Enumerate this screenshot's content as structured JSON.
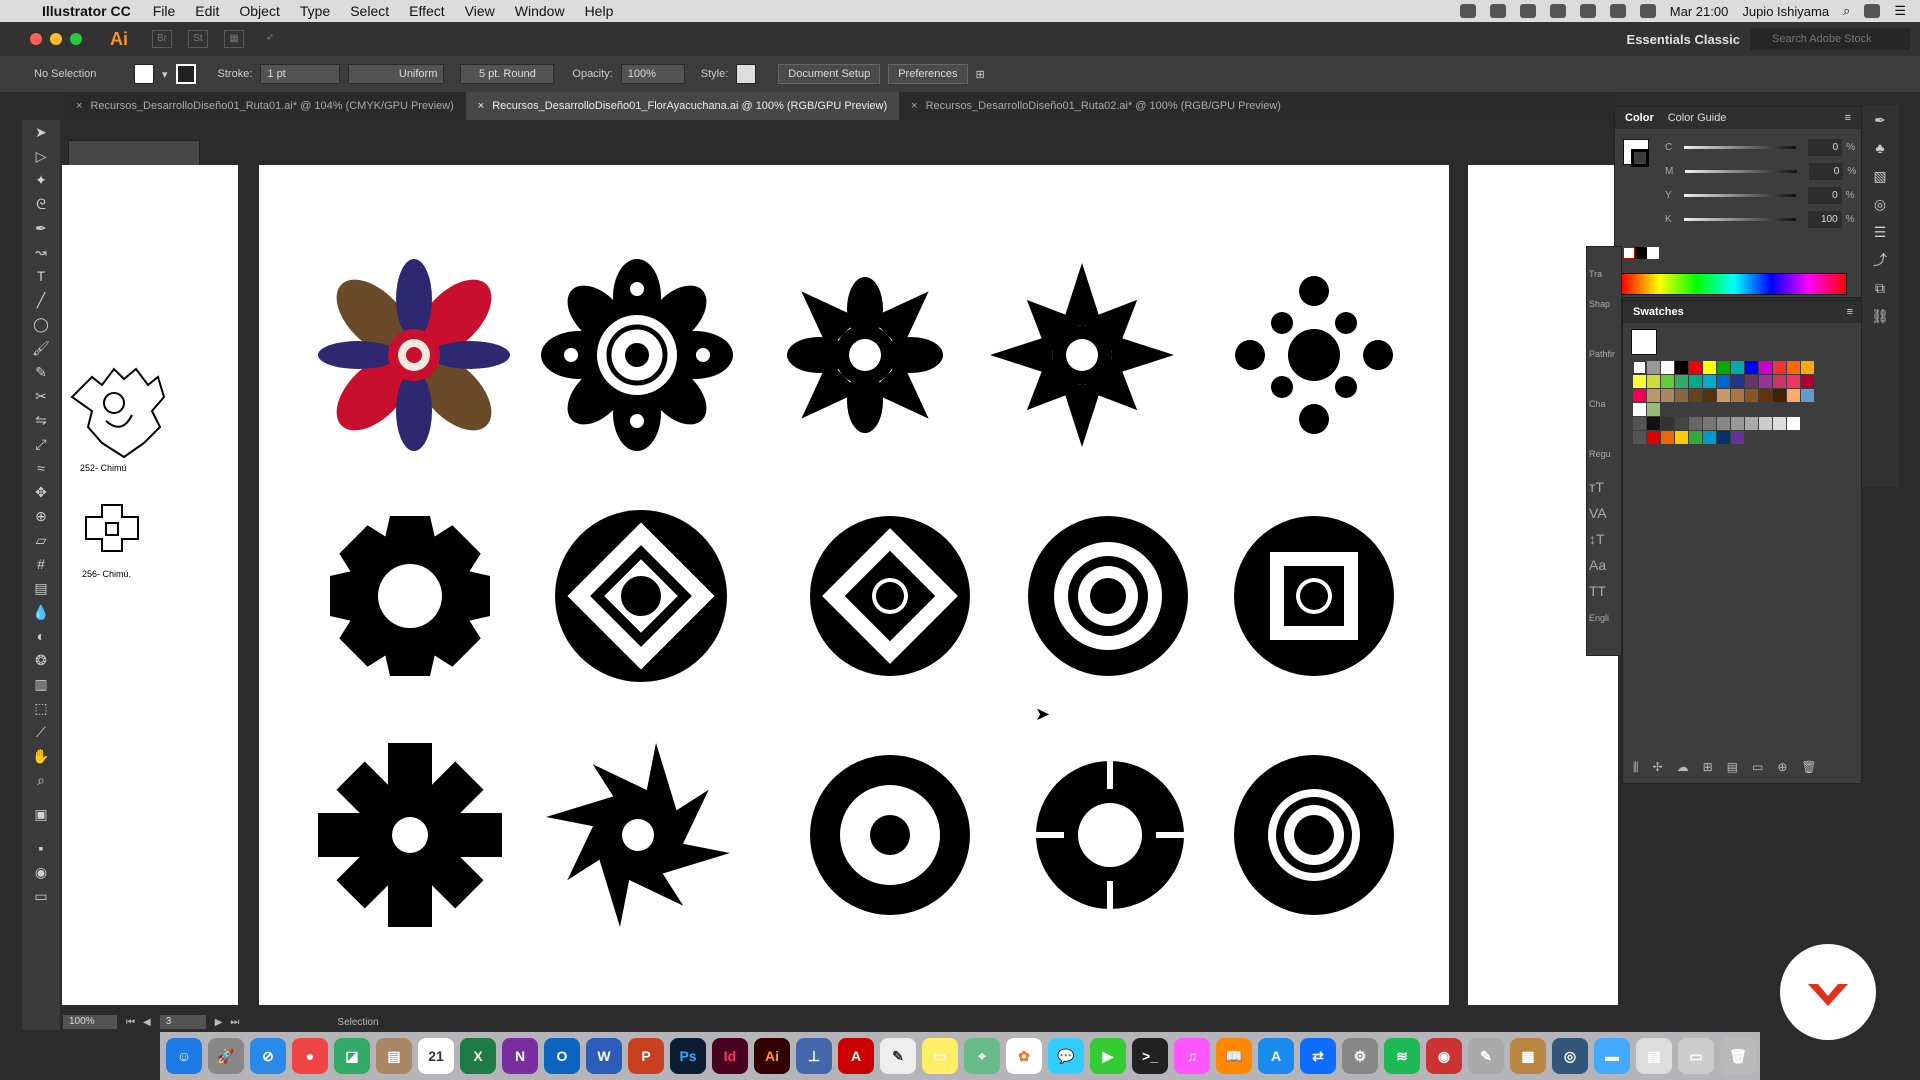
{
  "menubar": {
    "app": "Illustrator CC",
    "items": [
      "File",
      "Edit",
      "Object",
      "Type",
      "Select",
      "Effect",
      "View",
      "Window",
      "Help"
    ],
    "clock": "Mar 21:00",
    "user": "Jupio Ishiyama"
  },
  "appbar": {
    "logo": "Ai",
    "workspace": "Essentials Classic",
    "search_placeholder": "Search Adobe Stock"
  },
  "control": {
    "selection": "No Selection",
    "stroke_label": "Stroke:",
    "stroke_value": "1 pt",
    "profile": "Uniform",
    "brush": "5 pt. Round",
    "opacity_label": "Opacity:",
    "opacity_value": "100%",
    "style_label": "Style:",
    "doc_setup": "Document Setup",
    "preferences": "Preferences"
  },
  "tabs": [
    {
      "label": "Recursos_DesarrolloDiseño01_Ruta01.ai* @ 104% (CMYK/GPU Preview)"
    },
    {
      "label": "Recursos_DesarrolloDiseño01_FlorAyacuchana.ai @ 100% (RGB/GPU Preview)",
      "active": true
    },
    {
      "label": "Recursos_DesarrolloDiseño01_Ruta02.ai* @ 100% (RGB/GPU Preview)"
    }
  ],
  "left_artboard": {
    "caption1": "252- Chimú",
    "caption2": "256- Chimú."
  },
  "status": {
    "zoom": "100%",
    "page": "3",
    "tool": "Selection"
  },
  "color_panel": {
    "tab1": "Color",
    "tab2": "Color Guide",
    "c_label": "C",
    "c": "0",
    "m_label": "M",
    "m": "0",
    "y_label": "Y",
    "y": "0",
    "k_label": "K",
    "k": "100",
    "unit": "%"
  },
  "trans_panel": {
    "tr": "Tra",
    "shape": "Shap",
    "pathfinder": "Pathfir",
    "char": "Cha",
    "regular": "Regu",
    "lang": "Engli"
  },
  "swatches_panel": {
    "title": "Swatches"
  },
  "dock": {
    "apps": [
      "Finder",
      "Launchpad",
      "Safari",
      "Chrome",
      "Preview",
      "Notes",
      "Calendar",
      "Excel",
      "OneNote",
      "Outlook",
      "Word",
      "PowerPoint",
      "Photoshop",
      "InDesign",
      "Illustrator",
      "Keynote",
      "Acrobat",
      "TextEdit",
      "Stickies",
      "Maps",
      "Photos",
      "Messages",
      "FaceTime",
      "Terminal",
      "iTunes",
      "Books",
      "App Store",
      "TeamViewer",
      "System Preferences",
      "Spotify",
      "Photo Booth",
      "Script Editor",
      "Archive",
      "Chrome Helper",
      "Folder",
      "Files",
      "Preview2",
      "Trash"
    ],
    "calendar_day": "21",
    "calendar_month": "MAR"
  }
}
